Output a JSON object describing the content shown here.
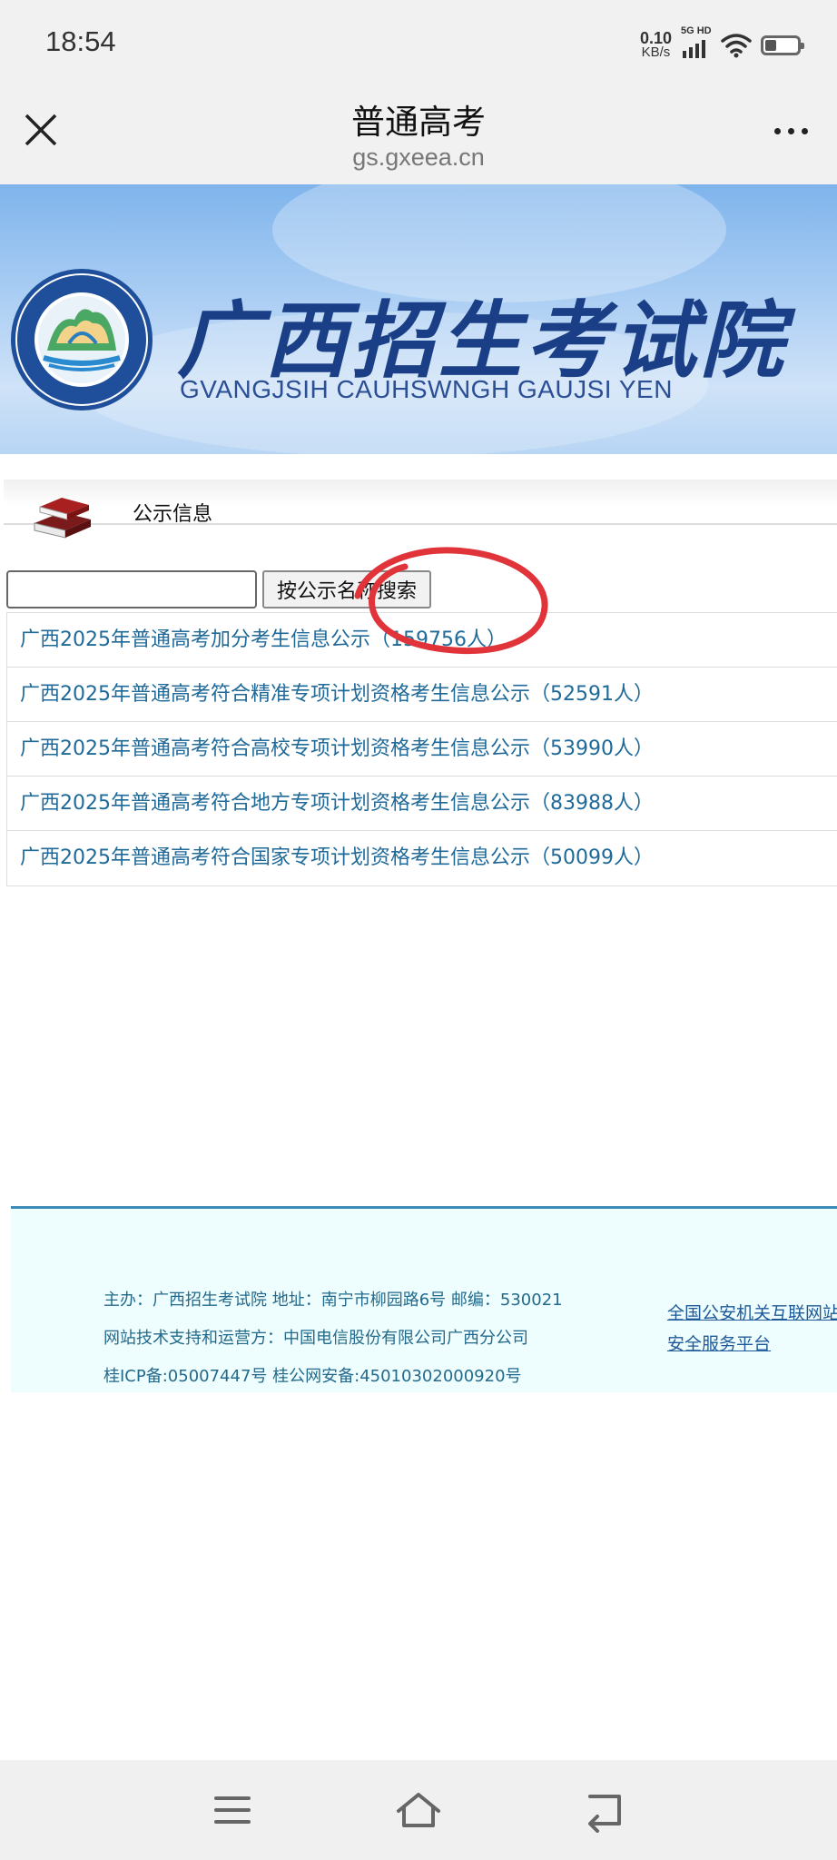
{
  "status_bar": {
    "time": "18:54",
    "net_speed_value": "0.10",
    "net_speed_unit": "KB/s",
    "signal_label": "5G HD"
  },
  "browser": {
    "title": "普通高考",
    "domain": "gs.gxeea.cn"
  },
  "banner": {
    "title_cn": "广西招生考试院",
    "title_en": "GVANGJSIH CAUHSWNGH GAUJSI YEN"
  },
  "section": {
    "title": "公示信息"
  },
  "search": {
    "input_value": "",
    "button_label": "按公示名称搜索"
  },
  "list_items": [
    "广西2025年普通高考加分考生信息公示（159756人）",
    "广西2025年普通高考符合精准专项计划资格考生信息公示（52591人）",
    "广西2025年普通高考符合高校专项计划资格考生信息公示（53990人）",
    "广西2025年普通高考符合地方专项计划资格考生信息公示（83988人）",
    "广西2025年普通高考符合国家专项计划资格考生信息公示（50099人）"
  ],
  "footer": {
    "line1": "主办：广西招生考试院 地址：南宁市柳园路6号 邮编：530021",
    "line2": "网站技术支持和运营方：中国电信股份有限公司广西分公司",
    "line3": "桂ICP备:05007447号 桂公网安备:45010302000920号",
    "link_line1": "全国公安机关互联网站",
    "link_line2": "安全服务平台"
  },
  "colors": {
    "link": "#1f6a99",
    "annotation": "#e0343a",
    "footer_bg": "#eefdfd",
    "footer_border": "#3d8ab8"
  }
}
